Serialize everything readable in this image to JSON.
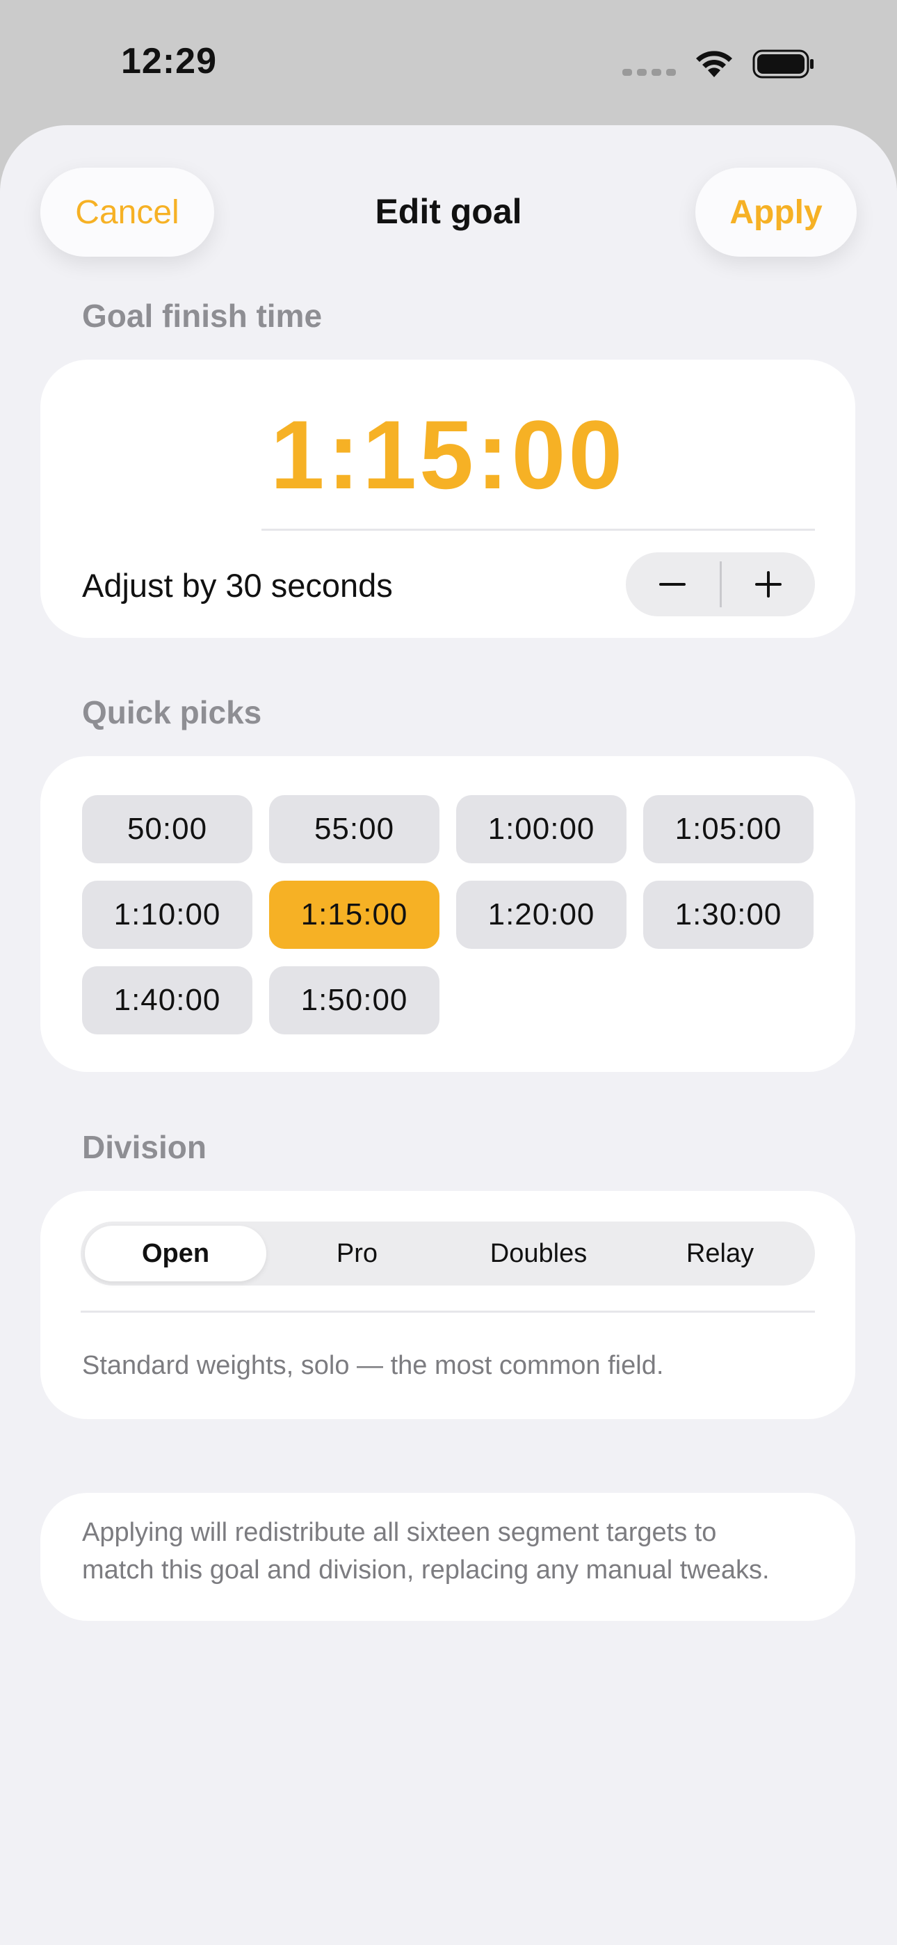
{
  "status_bar": {
    "time": "12:29"
  },
  "nav": {
    "cancel": "Cancel",
    "title": "Edit goal",
    "apply": "Apply"
  },
  "goal": {
    "section_label": "Goal finish time",
    "value": "1:15:00",
    "adjust_label": "Adjust by 30 seconds",
    "decrement_icon": "minus-icon",
    "increment_icon": "plus-icon"
  },
  "quick_picks": {
    "section_label": "Quick picks",
    "options": [
      "50:00",
      "55:00",
      "1:00:00",
      "1:05:00",
      "1:10:00",
      "1:15:00",
      "1:20:00",
      "1:30:00",
      "1:40:00",
      "1:50:00"
    ],
    "selected": "1:15:00"
  },
  "division": {
    "section_label": "Division",
    "options": [
      "Open",
      "Pro",
      "Doubles",
      "Relay"
    ],
    "selected": "Open",
    "description": "Standard weights, solo — the most common field."
  },
  "note": {
    "line1": "Applying will redistribute all sixteen segment targets to",
    "line2": "match this goal and division, replacing any manual tweaks."
  },
  "colors": {
    "accent": "#f6b125",
    "background": "#f1f1f5",
    "chip": "#e3e3e7"
  }
}
